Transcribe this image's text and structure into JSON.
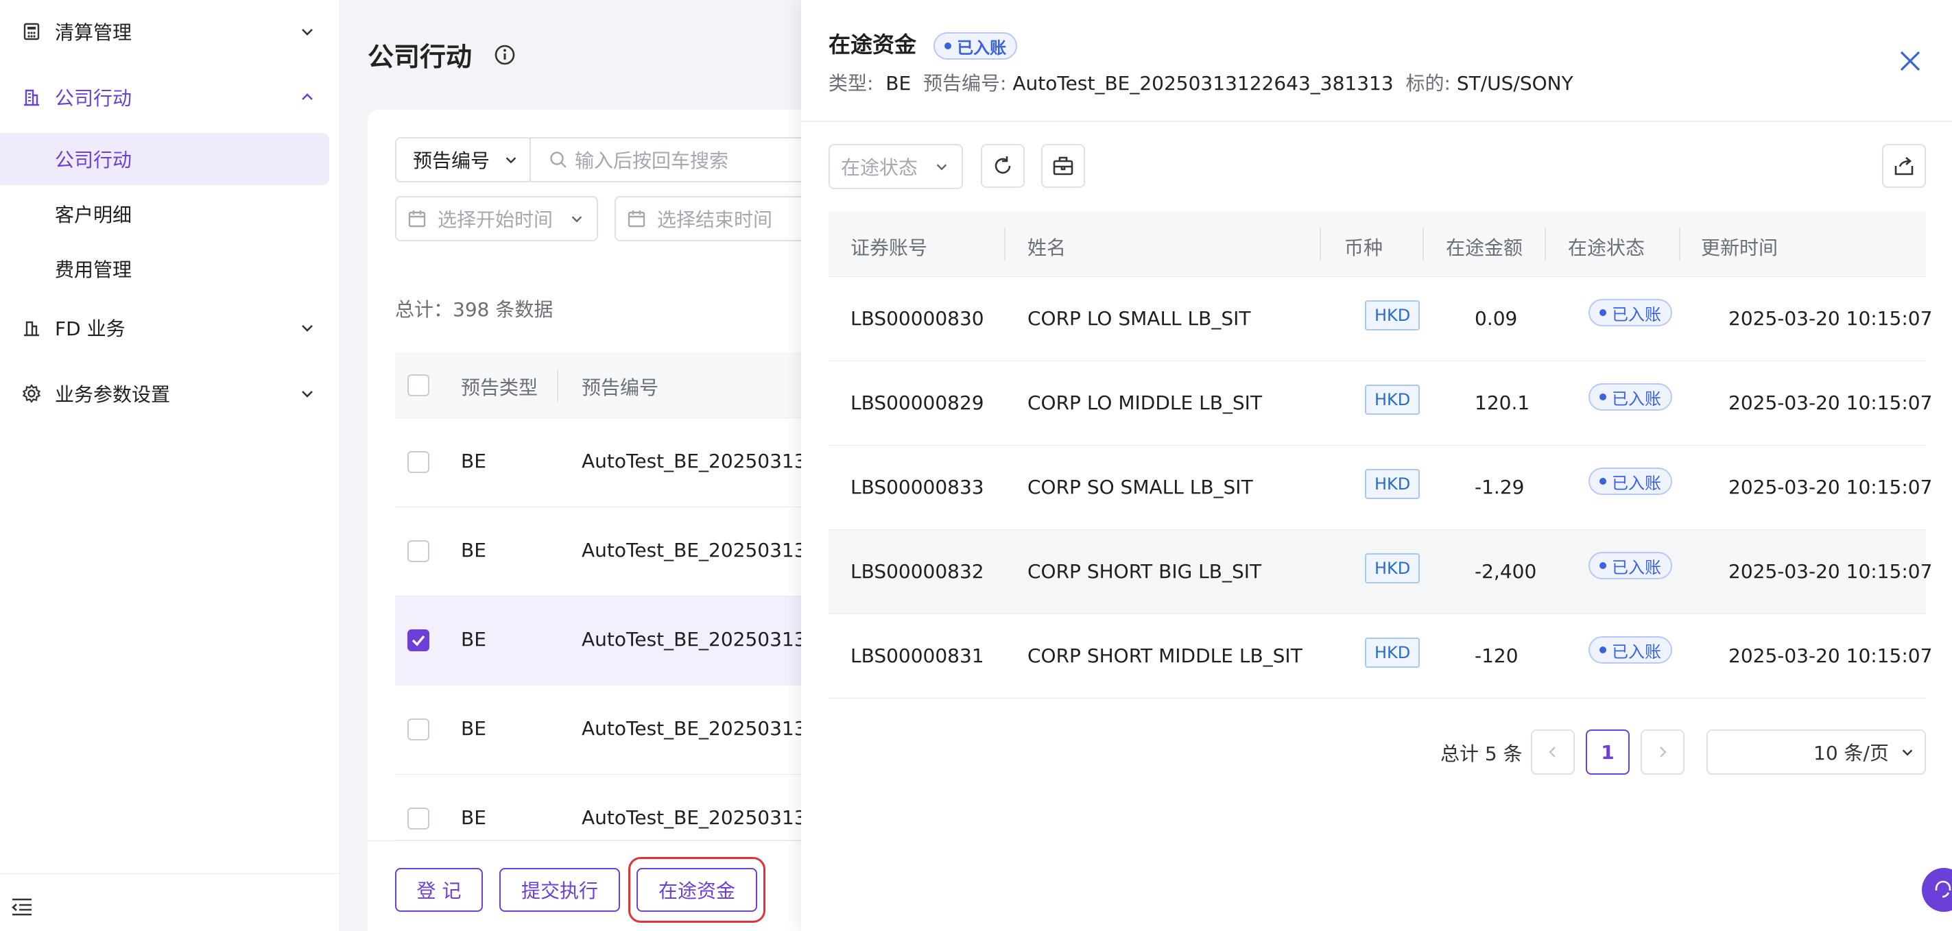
{
  "sidebar": {
    "items": [
      {
        "label": "清算管理",
        "icon": "calculator-icon",
        "expanded": false
      },
      {
        "label": "公司行动",
        "icon": "building-icon",
        "expanded": true,
        "children": [
          "公司行动",
          "客户明细",
          "费用管理"
        ]
      },
      {
        "label": "FD 业务",
        "icon": "bank-icon",
        "expanded": false
      },
      {
        "label": "业务参数设置",
        "icon": "gear-icon",
        "expanded": false
      }
    ],
    "active_child": "公司行动"
  },
  "main": {
    "title": "公司行动",
    "search": {
      "field_select": "预告编号",
      "placeholder": "输入后按回车搜索"
    },
    "date_start_placeholder": "选择开始时间",
    "date_end_placeholder": "选择结束时间",
    "total": "总计：398 条数据",
    "columns": [
      "预告类型",
      "预告编号"
    ],
    "rows": [
      {
        "type": "BE",
        "code": "AutoTest_BE_20250313",
        "checked": false
      },
      {
        "type": "BE",
        "code": "AutoTest_BE_20250313",
        "checked": false
      },
      {
        "type": "BE",
        "code": "AutoTest_BE_20250313",
        "checked": true
      },
      {
        "type": "BE",
        "code": "AutoTest_BE_20250313",
        "checked": false
      },
      {
        "type": "BE",
        "code": "AutoTest_BE_20250313",
        "checked": false
      }
    ],
    "buttons": {
      "register": "登 记",
      "submit": "提交执行",
      "in_transit": "在途资金"
    }
  },
  "drawer": {
    "title": "在途资金",
    "status_badge": "已入账",
    "meta": {
      "type_label": "类型:",
      "type_value": "BE",
      "code_label": "预告编号:",
      "code_value": "AutoTest_BE_20250313122643_381313",
      "target_label": "标的:",
      "target_value": "ST/US/SONY"
    },
    "filter_placeholder": "在途状态",
    "columns": [
      "证券账号",
      "姓名",
      "币种",
      "在途金额",
      "在途状态",
      "更新时间"
    ],
    "rows": [
      {
        "account": "LBS00000830",
        "name": "CORP LO SMALL LB_SIT",
        "currency": "HKD",
        "amount": "0.09",
        "status": "已入账",
        "updated": "2025-03-20 10:15:07"
      },
      {
        "account": "LBS00000829",
        "name": "CORP LO MIDDLE LB_SIT",
        "currency": "HKD",
        "amount": "120.1",
        "status": "已入账",
        "updated": "2025-03-20 10:15:07"
      },
      {
        "account": "LBS00000833",
        "name": "CORP SO SMALL LB_SIT",
        "currency": "HKD",
        "amount": "-1.29",
        "status": "已入账",
        "updated": "2025-03-20 10:15:07"
      },
      {
        "account": "LBS00000832",
        "name": "CORP SHORT BIG LB_SIT",
        "currency": "HKD",
        "amount": "-2,400",
        "status": "已入账",
        "updated": "2025-03-20 10:15:07"
      },
      {
        "account": "LBS00000831",
        "name": "CORP SHORT MIDDLE LB_SIT",
        "currency": "HKD",
        "amount": "-120",
        "status": "已入账",
        "updated": "2025-03-20 10:15:07"
      }
    ],
    "pagination": {
      "total": "总计 5 条",
      "current_page": "1",
      "page_size": "10 条/页"
    }
  },
  "colors": {
    "accent": "#6b3fd8",
    "highlight_ring": "#e0323a",
    "status_blue": "#3a62e0"
  }
}
